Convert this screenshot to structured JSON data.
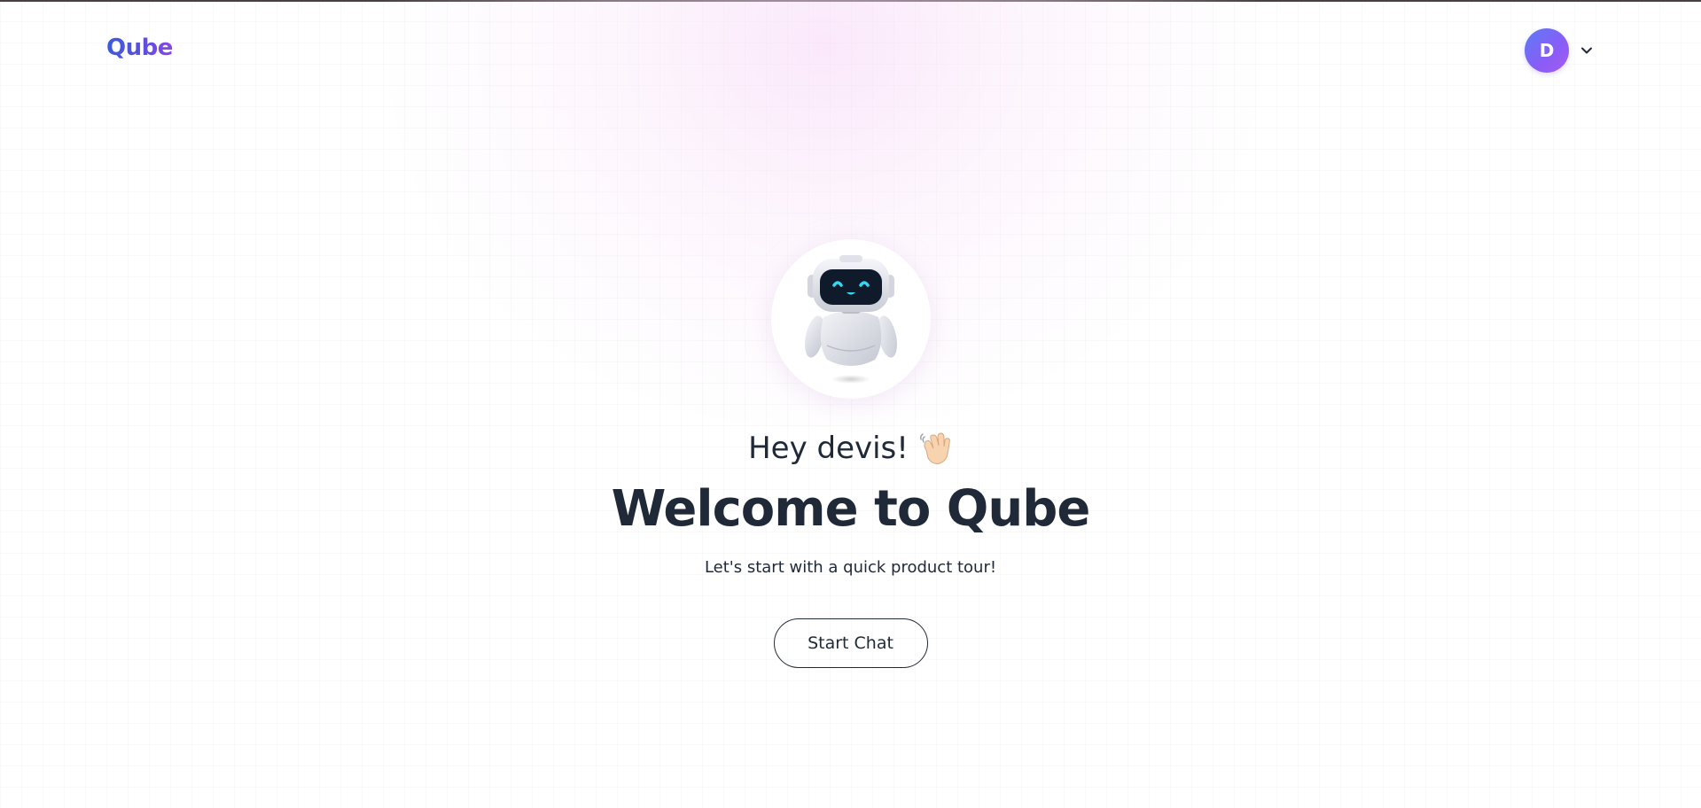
{
  "header": {
    "logo_text": "Qube",
    "avatar_initial": "D",
    "chevron_icon": "chevron-down-icon"
  },
  "hero": {
    "robot_icon": "robot-mascot-icon",
    "greeting": "Hey devis!",
    "greeting_icon": "waving-hand-icon",
    "title": "Welcome to Qube",
    "subtitle": "Let's start with a quick product tour!",
    "cta_label": "Start Chat"
  },
  "colors": {
    "brand_blue": "#3b5bdb",
    "brand_purple": "#8e44e6",
    "text_dark": "#1f2937",
    "avatar_gradient_start": "#5b7cf6",
    "avatar_gradient_end": "#a45cf0"
  }
}
